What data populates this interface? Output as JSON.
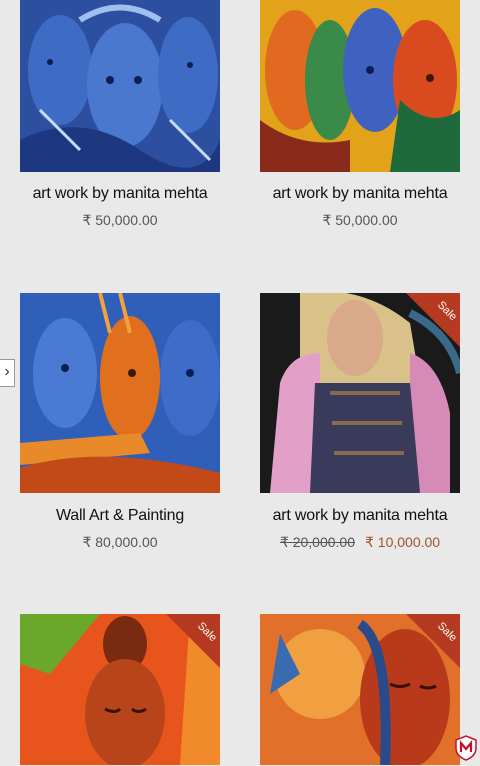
{
  "products": [
    {
      "title": "art work by manita mehta",
      "price": "₹ 50,000.00",
      "sale": false
    },
    {
      "title": "art work by manita mehta",
      "price": "₹ 50,000.00",
      "sale": false
    },
    {
      "title": "Wall Art & Painting",
      "price": "₹ 80,000.00",
      "sale": false
    },
    {
      "title": "art work by manita mehta",
      "old_price": "₹ 20,000.00",
      "price": "₹ 10,000.00",
      "sale": true,
      "sale_label": "Sale"
    },
    {
      "sale": true,
      "sale_label": "Sale"
    },
    {
      "sale": true,
      "sale_label": "Sale"
    }
  ],
  "nav": {
    "prev_arrow": "›"
  },
  "colors": {
    "sale_badge": "#b63a22",
    "sale_price": "#a0522d",
    "background": "#e9e9e9"
  },
  "icons": {
    "security": "mcafee-shield-icon"
  }
}
